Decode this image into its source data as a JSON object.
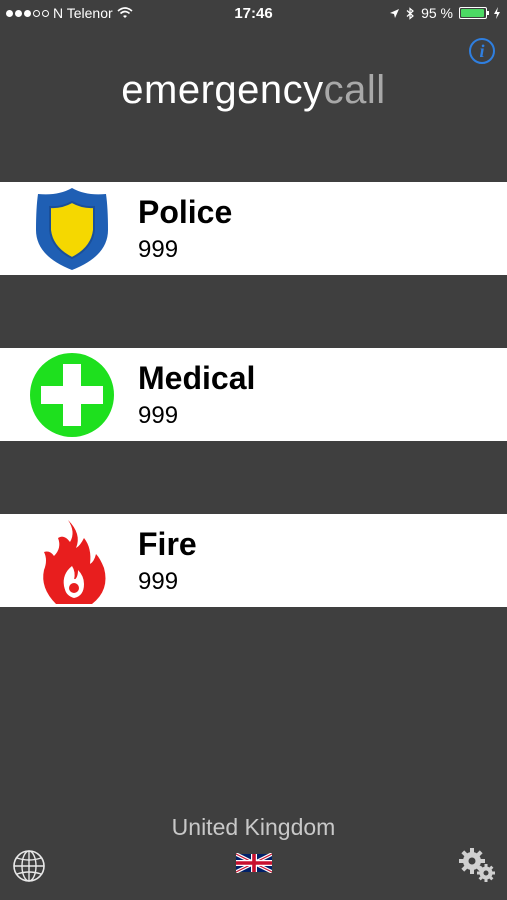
{
  "status_bar": {
    "carrier": "N Telenor",
    "time": "17:46",
    "battery": "95 %",
    "battery_level": 0.95,
    "battery_color": "#4cd964"
  },
  "header": {
    "title_part1": "emergency",
    "title_part2": "call",
    "info_label": "i",
    "info_color": "#2f7fe0"
  },
  "services": [
    {
      "name": "Police",
      "number": "999",
      "icon": "police-badge-icon"
    },
    {
      "name": "Medical",
      "number": "999",
      "icon": "medical-cross-icon"
    },
    {
      "name": "Fire",
      "number": "999",
      "icon": "fire-icon"
    }
  ],
  "footer": {
    "country": "United Kingdom",
    "globe_icon": "globe-icon",
    "flag_icon": "uk-flag-icon",
    "settings_icon": "gears-icon"
  },
  "colors": {
    "background": "#3f3f3f",
    "row_background": "#ffffff",
    "police_blue": "#1f5fb4",
    "police_yellow": "#f5d800",
    "medical_green": "#1ee01e",
    "fire_red": "#e81e1e"
  }
}
